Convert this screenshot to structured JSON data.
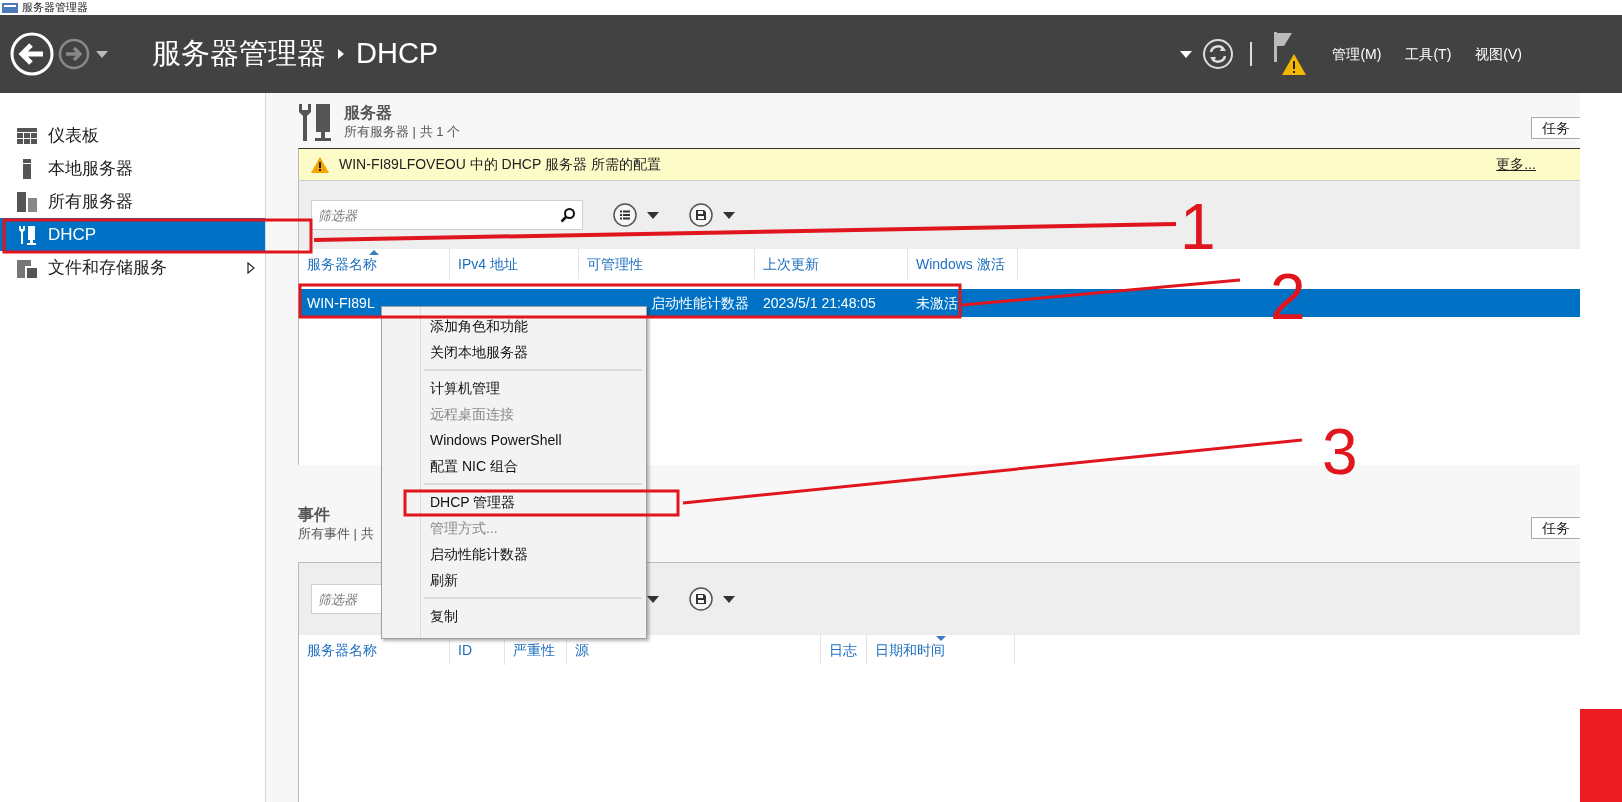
{
  "window": {
    "title": "服务器管理器"
  },
  "header": {
    "breadcrumb": [
      "服务器管理器",
      "DHCP"
    ],
    "menus": [
      "管理(M)",
      "工具(T)",
      "视图(V)"
    ]
  },
  "sidebar": {
    "items": [
      {
        "kind": "dashboard",
        "label": "仪表板",
        "selected": false,
        "expandable": false
      },
      {
        "kind": "local",
        "label": "本地服务器",
        "selected": false,
        "expandable": false
      },
      {
        "kind": "all",
        "label": "所有服务器",
        "selected": false,
        "expandable": false
      },
      {
        "kind": "dhcp",
        "label": "DHCP",
        "selected": true,
        "expandable": false
      },
      {
        "kind": "storage",
        "label": "文件和存储服务",
        "selected": false,
        "expandable": true
      }
    ]
  },
  "servers": {
    "title": "服务器",
    "subtitle": "所有服务器 | 共 1 个",
    "tasks_button": "任务",
    "notice": {
      "text": "WIN-FI89LFOVEOU 中的 DHCP 服务器 所需的配置",
      "link": "更多..."
    },
    "filter": {
      "placeholder": "筛选器"
    },
    "columns": [
      {
        "label": "服务器名称",
        "sorted": true,
        "descending": false
      },
      {
        "label": "IPv4 地址",
        "sorted": false
      },
      {
        "label": "可管理性",
        "sorted": false
      },
      {
        "label": "上次更新",
        "sorted": false
      },
      {
        "label": "Windows 激活",
        "sorted": false
      }
    ],
    "rows": [
      {
        "selected": true,
        "cells": [
          "WIN-FI89L",
          "",
          "启动性能计数器",
          "2023/5/1 21:48:05",
          "未激活"
        ]
      }
    ]
  },
  "context_menu": {
    "items": [
      {
        "kind": "item",
        "label": "添加角色和功能",
        "disabled": false
      },
      {
        "kind": "item",
        "label": "关闭本地服务器",
        "disabled": false
      },
      {
        "kind": "separator"
      },
      {
        "kind": "item",
        "label": "计算机管理",
        "disabled": false
      },
      {
        "kind": "item",
        "label": "远程桌面连接",
        "disabled": true
      },
      {
        "kind": "item",
        "label": "Windows PowerShell",
        "disabled": false
      },
      {
        "kind": "item",
        "label": "配置 NIC 组合",
        "disabled": false
      },
      {
        "kind": "separator"
      },
      {
        "kind": "item",
        "label": "DHCP 管理器",
        "disabled": false
      },
      {
        "kind": "item",
        "label": "管理方式...",
        "disabled": true
      },
      {
        "kind": "item",
        "label": "启动性能计数器",
        "disabled": false
      },
      {
        "kind": "item",
        "label": "刷新",
        "disabled": false
      },
      {
        "kind": "separator"
      },
      {
        "kind": "item",
        "label": "复制",
        "disabled": false
      }
    ]
  },
  "events": {
    "title": "事件",
    "subtitle": "所有事件 | 共",
    "tasks_button": "任务",
    "filter": {
      "placeholder": "筛选器"
    },
    "columns": [
      {
        "label": "服务器名称",
        "sorted": false
      },
      {
        "label": "ID",
        "sorted": false
      },
      {
        "label": "严重性",
        "sorted": false
      },
      {
        "label": "源",
        "sorted": false
      },
      {
        "label": "日志",
        "sorted": false
      },
      {
        "label": "日期和时间",
        "sorted": true,
        "descending": true
      }
    ]
  },
  "annotations": [
    "1",
    "2",
    "3"
  ]
}
